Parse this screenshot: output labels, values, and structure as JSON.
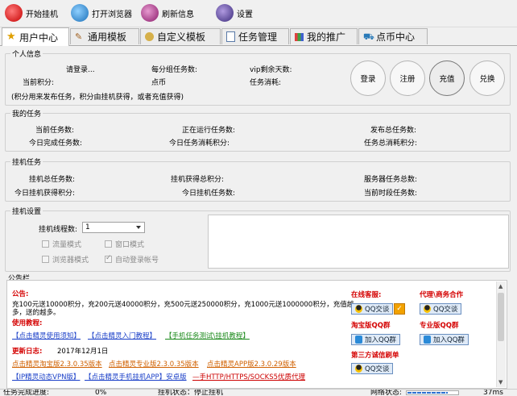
{
  "toolbar": {
    "start": "开始挂机",
    "browser": "打开浏览器",
    "refresh": "刷新信息",
    "settings": "设置"
  },
  "tabs": [
    "用户中心",
    "通用模板",
    "自定义模板",
    "任务管理",
    "我的推广",
    "点币中心"
  ],
  "personal": {
    "title": "个人信息",
    "login_status": "请登录...",
    "tasks_per_group": "每分组任务数:",
    "vip_days": "vip剩余天数:",
    "current_points": "当前积分:",
    "coins": "点币",
    "task_cost": "任务消耗:",
    "note": "(积分用来发布任务，积分由挂机获得，或者充值获得)",
    "buttons": [
      "登录",
      "注册",
      "充值",
      "兑换"
    ]
  },
  "my_tasks": {
    "title": "我的任务",
    "current": "当前任务数:",
    "running": "正在运行任务数:",
    "published": "发布总任务数:",
    "today_done": "今日完成任务数:",
    "today_cost": "今日任务消耗积分:",
    "total_cost": "任务总消耗积分:"
  },
  "hang_tasks": {
    "title": "挂机任务",
    "total": "挂机总任务数:",
    "earned": "挂机获得总积分:",
    "server_total": "服务器任务总数:",
    "today_points": "今日挂机获得积分:",
    "today_tasks": "今日挂机任务数:",
    "period_tasks": "当前时段任务数:"
  },
  "settings": {
    "title": "挂机设置",
    "threads_label": "挂机线程数:",
    "threads_value": "1",
    "opt_traffic": "流量模式",
    "opt_window": "窗口模式",
    "opt_browser": "浏览器模式",
    "opt_autologin": "自动登录帐号"
  },
  "notice": {
    "title": "公告栏",
    "announce_h": "公告:",
    "announce_1": "充100元送10000积分，充200元送40000积分，充500元送250000积分，充1000元送1000000积分，充值越",
    "announce_2": "多，送的越多。",
    "tutorial_h": "使用教程:",
    "tut_1": "【点击精灵使用须知】",
    "tut_2": "【点击精灵入门教程】",
    "tut_3": "【手机任务测试\\挂机教程】",
    "update_h": "更新日志:",
    "update_date": "2017年12月1日",
    "dl_1": "点击精灵淘宝版2.3.0.35版本",
    "dl_2": "点击精灵专业版2.3.0.35版本",
    "dl_3": "点击精灵APP版2.3.0.29版本",
    "vpn": "【IP精灵动态VPN版】",
    "app": "【点击精灵手机挂机APP】安卓版",
    "proxy": "—手HTTP/HTTPS/SOCKS5优质代理",
    "online_cs": "在线客服:",
    "agent": "代理\\商务合作",
    "taobao_group": "淘宝版QQ群",
    "pro_group": "专业版QQ群",
    "third_party": "第三方诚信刷单",
    "qq_chat": "QQ交谈",
    "join_group": "加入QQ群"
  },
  "status": {
    "progress_label": "任务完成进度:",
    "progress_value": "0%",
    "hang_state": "挂机状态：停止挂机",
    "net_state": "网络状态:",
    "ms": "37ms"
  },
  "colors": {
    "accent_blue": "#1b40c8",
    "notice_red": "#d40000",
    "link_green": "#1c8a1c",
    "link_orange": "#d06000"
  }
}
